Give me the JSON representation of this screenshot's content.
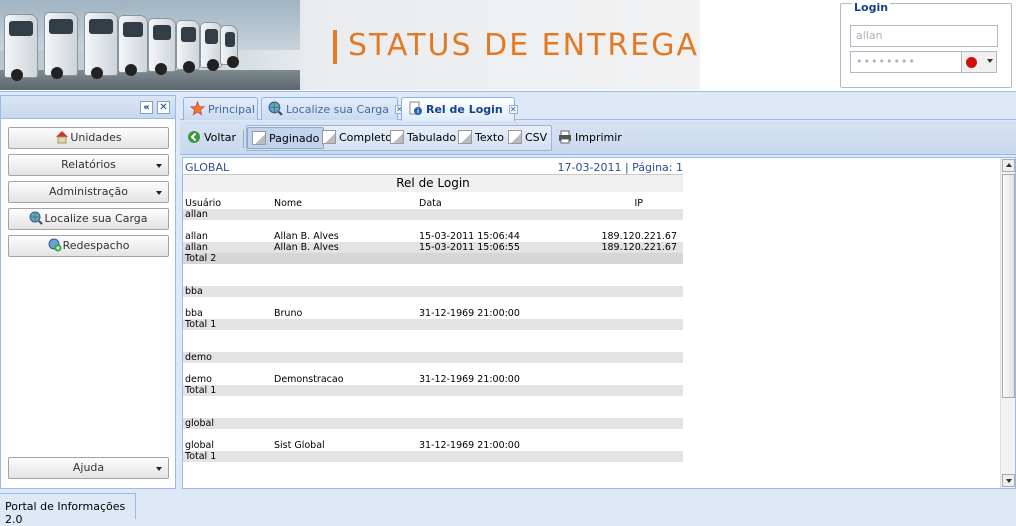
{
  "header": {
    "app_title": "STATUS DE ENTREGA",
    "login": {
      "legend": "Login",
      "user_value": "allan",
      "password_mask": "••••••••"
    }
  },
  "west": {
    "buttons": [
      {
        "label": "Unidades"
      },
      {
        "label": "Relatórios"
      },
      {
        "label": "Administração"
      },
      {
        "label": "Localize sua Carga"
      },
      {
        "label": "Redespacho"
      }
    ],
    "help_label": "Ajuda"
  },
  "tabs": [
    {
      "label": "Principal"
    },
    {
      "label": "Localize sua Carga"
    },
    {
      "label": "Rel de Login"
    }
  ],
  "toolbar": {
    "back": "Voltar",
    "paged": "Paginado",
    "complete": "Completo",
    "tabbed": "Tabulado",
    "text": "Texto",
    "csv": "CSV",
    "print": "Imprimir"
  },
  "report": {
    "company": "GLOBAL",
    "date_page": "17-03-2011 | Página: 1",
    "title": "Rel de Login",
    "columns": [
      "Usuário",
      "Nome",
      "Data",
      "IP"
    ],
    "groups": [
      {
        "user": "allan",
        "rows": [
          [
            "allan",
            "Allan B. Alves",
            "15-03-2011 15:06:44",
            "189.120.221.67"
          ],
          [
            "allan",
            "Allan B. Alves",
            "15-03-2011 15:06:55",
            "189.120.221.67"
          ]
        ],
        "total": "Total 2"
      },
      {
        "user": "bba",
        "rows": [
          [
            "bba",
            "Bruno",
            "31-12-1969 21:00:00",
            ""
          ]
        ],
        "total": "Total 1"
      },
      {
        "user": "demo",
        "rows": [
          [
            "demo",
            "Demonstracao",
            "31-12-1969 21:00:00",
            ""
          ]
        ],
        "total": "Total 1"
      },
      {
        "user": "global",
        "rows": [
          [
            "global",
            "Sist Global",
            "31-12-1969 21:00:00",
            ""
          ]
        ],
        "total": "Total 1"
      }
    ]
  },
  "status_text": "Portal de Informações 2.0"
}
